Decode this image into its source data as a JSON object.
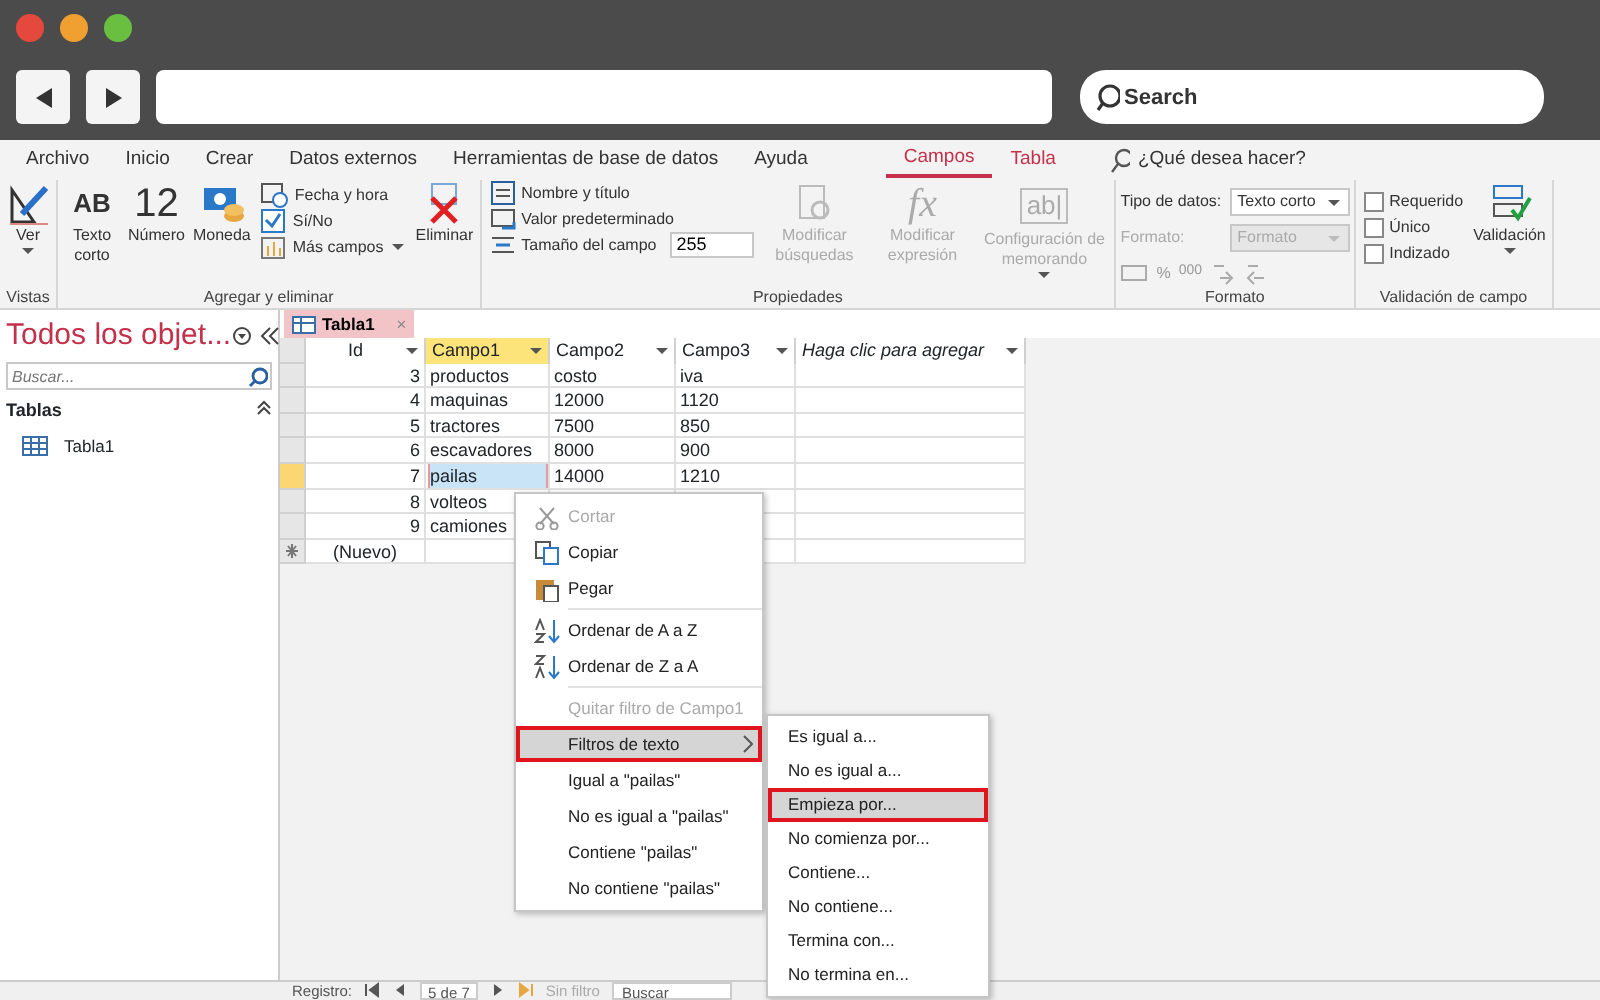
{
  "browser": {
    "search_placeholder": "Search"
  },
  "ribbon": {
    "tabs": [
      {
        "label": "Archivo",
        "selected": false,
        "contextual": false
      },
      {
        "label": "Inicio",
        "selected": false,
        "contextual": false
      },
      {
        "label": "Crear",
        "selected": false,
        "contextual": false
      },
      {
        "label": "Datos externos",
        "selected": false,
        "contextual": false
      },
      {
        "label": "Herramientas de base de datos",
        "selected": false,
        "contextual": false
      },
      {
        "label": "Ayuda",
        "selected": false,
        "contextual": false
      },
      {
        "label": "Campos",
        "selected": true,
        "contextual": true
      },
      {
        "label": "Tabla",
        "selected": false,
        "contextual": true
      }
    ],
    "tell_me": "¿Qué desea hacer?",
    "vistas": {
      "label": "Vistas",
      "ver": "Ver"
    },
    "agregar": {
      "label": "Agregar y eliminar",
      "texto_corto_glyph": "AB",
      "texto_corto": "Texto corto",
      "numero_glyph": "12",
      "numero": "Número",
      "moneda": "Moneda",
      "fecha": "Fecha y hora",
      "si_no": "Sí/No",
      "mas_campos": "Más campos",
      "eliminar": "Eliminar"
    },
    "propiedades": {
      "label": "Propiedades",
      "nombre": "Nombre y título",
      "valor": "Valor predeterminado",
      "tamano": "Tamaño del campo",
      "tamano_value": "255",
      "busquedas": "Modificar búsquedas",
      "expresion_glyph": "fx",
      "expresion": "Modificar expresión",
      "memo_glyph": "ab|",
      "memorando": "Configuración de memorando"
    },
    "formato": {
      "label": "Formato",
      "tipo_label": "Tipo de datos:",
      "tipo_value": "Texto corto",
      "formato_label": "Formato:",
      "formato_value": "Formato",
      "percent": "%",
      "thousands": "000"
    },
    "validacion": {
      "label": "Validación de campo",
      "checks": [
        {
          "label": "Requerido",
          "checked": false
        },
        {
          "label": "Único",
          "checked": false
        },
        {
          "label": "Indizado",
          "checked": false
        }
      ],
      "button": "Validación"
    }
  },
  "nav": {
    "title": "Todos los objet...",
    "search_placeholder": "Buscar...",
    "section": "Tablas",
    "items": [
      "Tabla1"
    ]
  },
  "document_tab": {
    "label": "Tabla1",
    "close": "×"
  },
  "table": {
    "columns": [
      {
        "label": "Id",
        "italic": false,
        "selected": false
      },
      {
        "label": "Campo1",
        "italic": false,
        "selected": true
      },
      {
        "label": "Campo2",
        "italic": false,
        "selected": false
      },
      {
        "label": "Campo3",
        "italic": false,
        "selected": false
      },
      {
        "label": "Haga clic para agregar",
        "italic": true,
        "selected": false
      }
    ],
    "rows": [
      {
        "cells": [
          "3",
          "productos",
          "costo",
          "iva"
        ],
        "selected": false
      },
      {
        "cells": [
          "4",
          "maquinas",
          "12000",
          "1120"
        ],
        "selected": false
      },
      {
        "cells": [
          "5",
          "tractores",
          "7500",
          "850"
        ],
        "selected": false
      },
      {
        "cells": [
          "6",
          "escavadores",
          "8000",
          "900"
        ],
        "selected": false
      },
      {
        "cells": [
          "7",
          "pailas",
          "14000",
          "1210"
        ],
        "selected": true
      },
      {
        "cells": [
          "8",
          "volteos"
        ],
        "selected": false
      },
      {
        "cells": [
          "9",
          "camiones"
        ],
        "selected": false
      }
    ],
    "new_row": "(Nuevo)"
  },
  "status_bar": {
    "label": "Registro:",
    "position": "5 de 7",
    "filter": "Sin filtro",
    "search": "Buscar"
  },
  "context_menu": {
    "items": [
      {
        "kind": "cut",
        "label": "Cortar",
        "disabled": true,
        "selected": false
      },
      {
        "kind": "copy",
        "label": "Copiar",
        "disabled": false,
        "selected": false
      },
      {
        "kind": "paste",
        "label": "Pegar",
        "disabled": false,
        "selected": false
      },
      {
        "kind": "separator"
      },
      {
        "kind": "sortasc",
        "label": "Ordenar de A a Z",
        "disabled": false,
        "selected": false
      },
      {
        "kind": "sortdesc",
        "label": "Ordenar de Z a A",
        "disabled": false,
        "selected": false
      },
      {
        "kind": "separator"
      },
      {
        "kind": "plain",
        "label": "Quitar filtro de Campo1",
        "disabled": true,
        "selected": false
      },
      {
        "kind": "submenu",
        "label": "Filtros de texto",
        "disabled": false,
        "selected": true
      },
      {
        "kind": "plain",
        "label": "Igual a \"pailas\"",
        "disabled": false,
        "selected": false
      },
      {
        "kind": "plain",
        "label": "No es igual a \"pailas\"",
        "disabled": false,
        "selected": false
      },
      {
        "kind": "plain",
        "label": "Contiene \"pailas\"",
        "disabled": false,
        "selected": false
      },
      {
        "kind": "plain",
        "label": "No contiene \"pailas\"",
        "disabled": false,
        "selected": false
      }
    ]
  },
  "submenu": {
    "items": [
      {
        "label": "Es igual a...",
        "selected": false
      },
      {
        "label": "No es igual a...",
        "selected": false
      },
      {
        "label": "Empieza por...",
        "selected": true
      },
      {
        "label": "No comienza por...",
        "selected": false
      },
      {
        "label": "Contiene...",
        "selected": false
      },
      {
        "label": "No contiene...",
        "selected": false
      },
      {
        "label": "Termina con...",
        "selected": false
      },
      {
        "label": "No termina en...",
        "selected": false
      }
    ]
  }
}
